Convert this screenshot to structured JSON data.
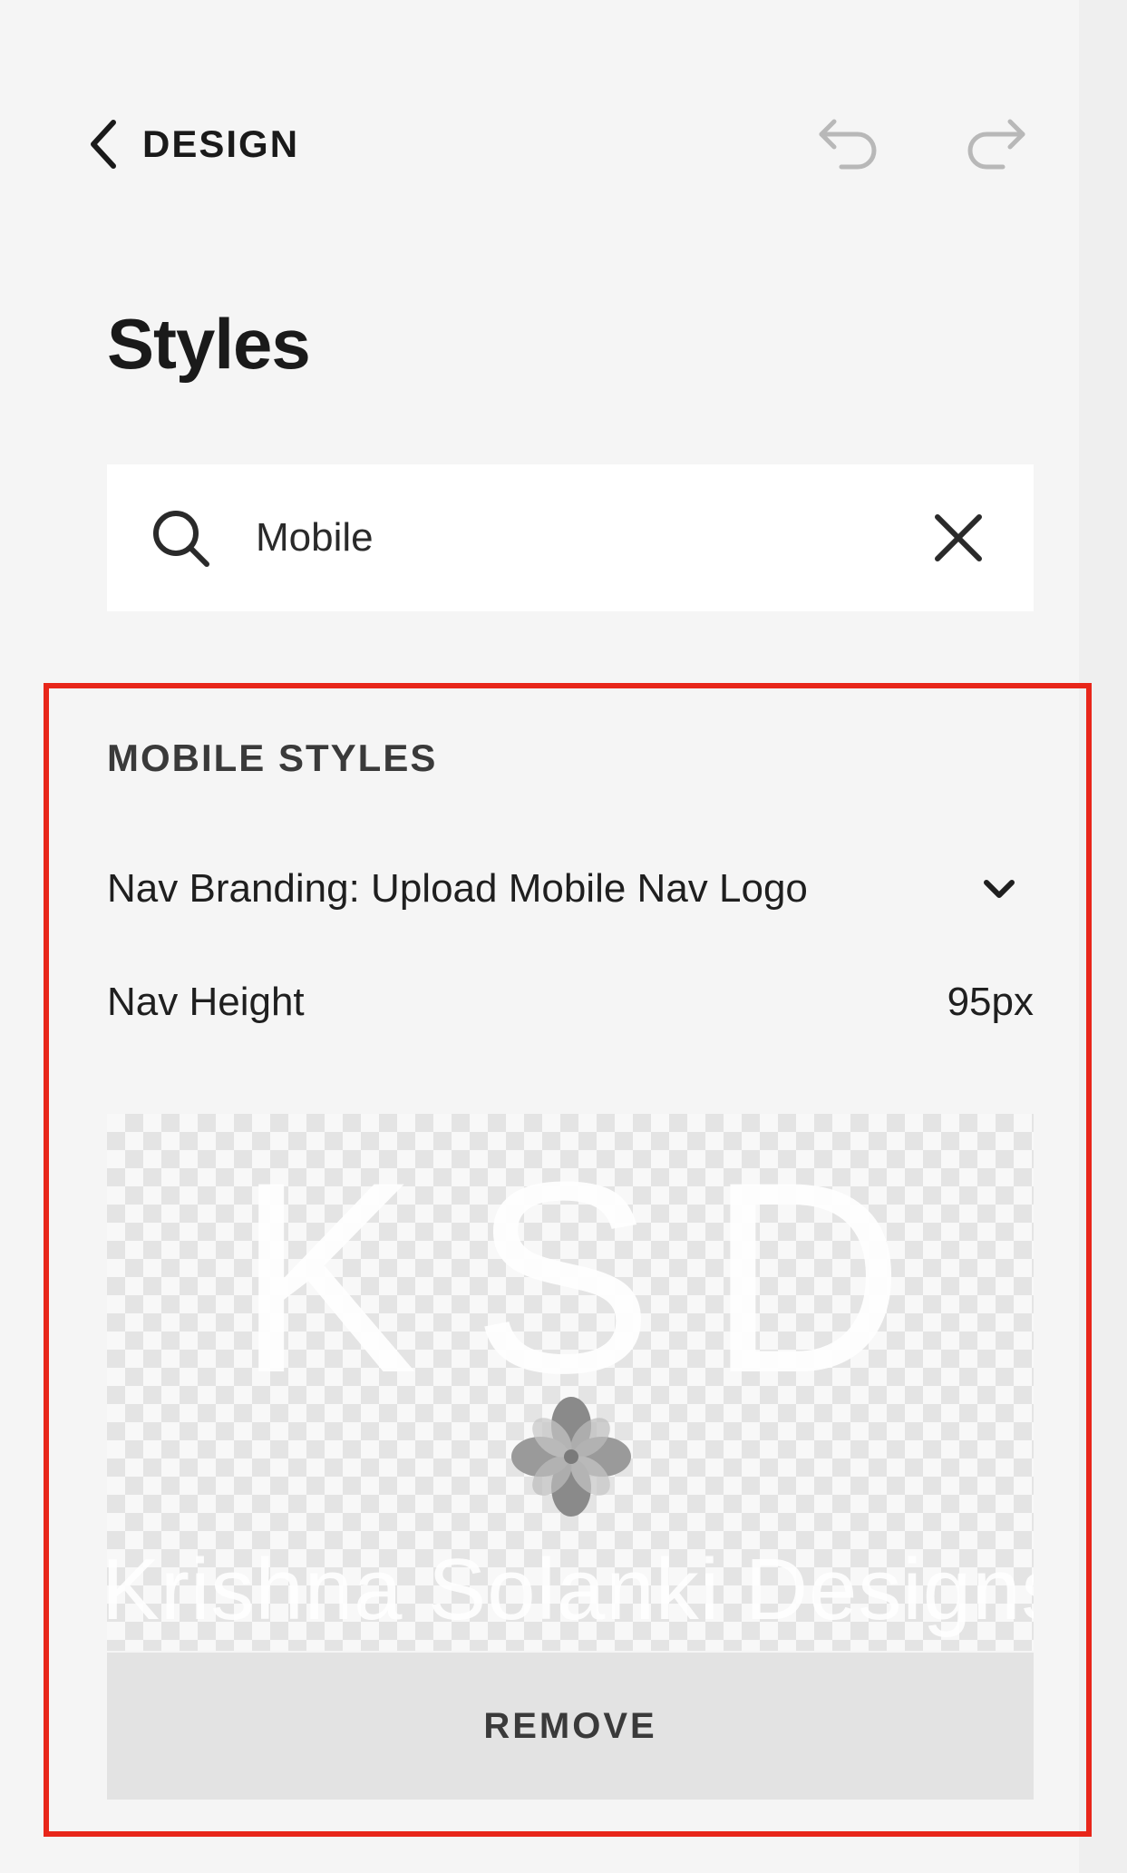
{
  "header": {
    "back_label": "DESIGN"
  },
  "page": {
    "title": "Styles"
  },
  "search": {
    "value": "Mobile",
    "placeholder": ""
  },
  "section": {
    "title": "MOBILE STYLES",
    "rows": [
      {
        "label": "Nav Branding: Upload Mobile Nav Logo",
        "control": "chevron-down-icon"
      },
      {
        "label": "Nav Height",
        "value": "95px"
      }
    ]
  },
  "logo": {
    "monogram": "KSD",
    "tagline": "Krishna Solanki Designs"
  },
  "remove_label": "REMOVE",
  "colors": {
    "background": "#f5f5f5",
    "highlight_border": "#e8261a",
    "remove_button_bg": "#e3e3e3",
    "icon_disabled": "#b8b8b8"
  },
  "icons": [
    "chevron-left-icon",
    "undo-icon",
    "redo-icon",
    "search-icon",
    "close-icon",
    "chevron-down-icon",
    "pinwheel-logo-icon"
  ]
}
